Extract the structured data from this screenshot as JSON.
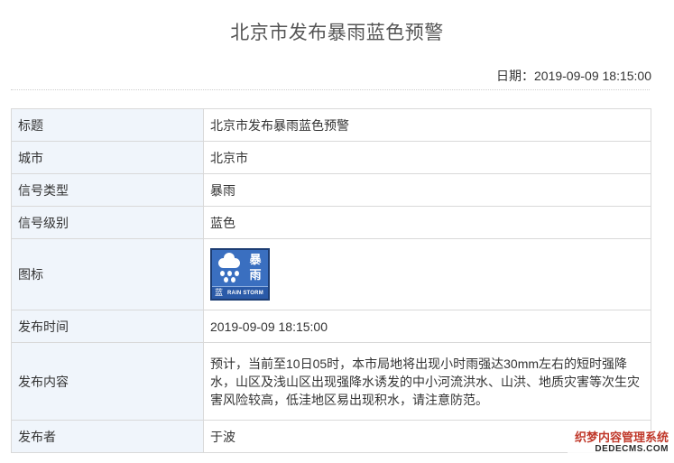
{
  "page": {
    "title": "北京市发布暴雨蓝色预警",
    "date_line": "日期：2019-09-09 18:15:00"
  },
  "rows": [
    {
      "label": "标题",
      "value": "北京市发布暴雨蓝色预警"
    },
    {
      "label": "城市",
      "value": "北京市"
    },
    {
      "label": "信号类型",
      "value": "暴雨"
    },
    {
      "label": "信号级别",
      "value": "蓝色"
    },
    {
      "label": "图标",
      "value": ""
    },
    {
      "label": "发布时间",
      "value": "2019-09-09 18:15:00"
    },
    {
      "label": "发布内容",
      "value": "预计，当前至10日05时，本市局地将出现小时雨强达30mm左右的短时强降水，山区及浅山区出现强降水诱发的中小河流洪水、山洪、地质灾害等次生灾害风险较高，低洼地区易出现积水，请注意防范。"
    },
    {
      "label": "发布者",
      "value": "于波"
    }
  ],
  "warning_icon": {
    "name": "rainstorm-blue-warning-icon",
    "glyph_top": "暴",
    "glyph_bottom": "雨",
    "level_char": "蓝",
    "en_label": "RAIN STORM",
    "color": "#3a6fc0"
  },
  "watermark": {
    "cn": "织梦内容管理系统",
    "en": "DEDECMS.COM"
  }
}
